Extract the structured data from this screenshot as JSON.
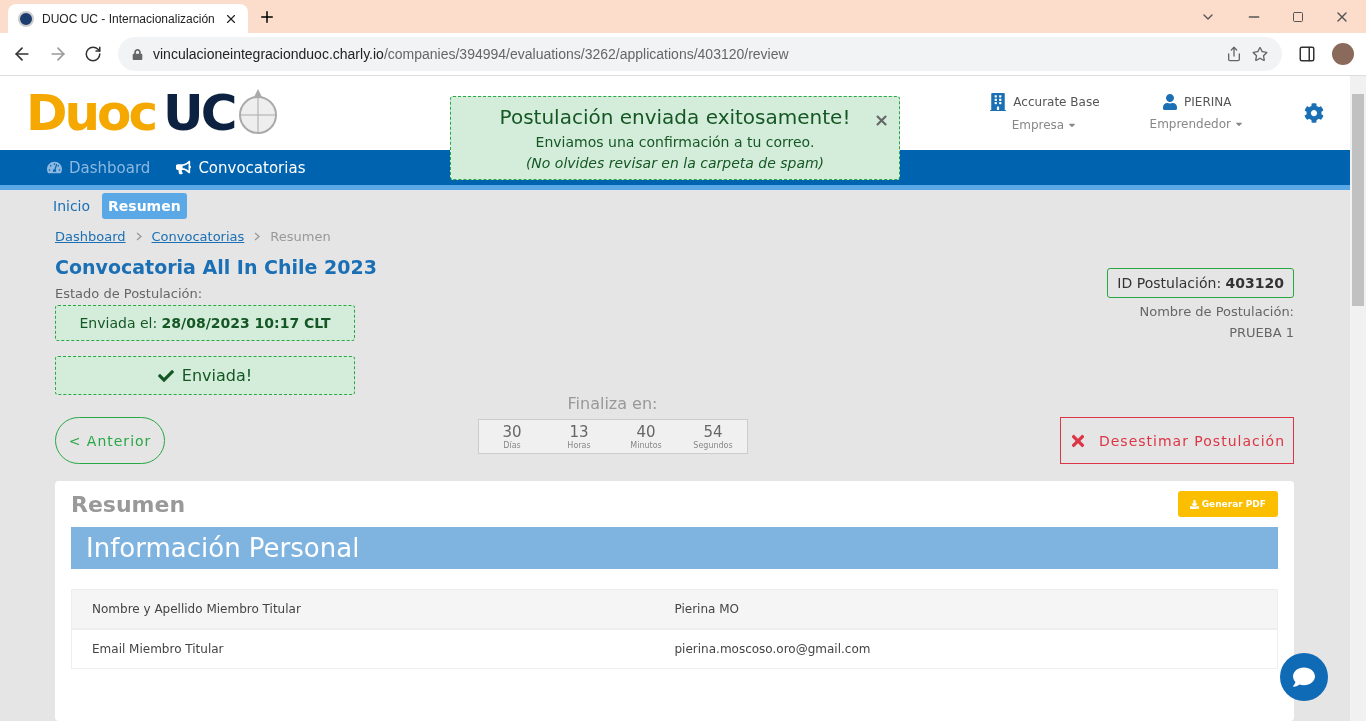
{
  "browser": {
    "tabs": [
      {
        "title": "DUOC UC - Internacionalización",
        "selected": true
      }
    ],
    "url": {
      "host": "vinculacioneintegracionduoc.charly.io",
      "path": "/companies/394994/evaluations/3262/applications/403120/review"
    }
  },
  "logo": {
    "part_1": "Duoc",
    "part_2": "UC"
  },
  "toast": {
    "title": "Postulación enviada exitosamente!",
    "close": "×",
    "message": "Enviamos una confirmación a tu correo.",
    "note": "(No olvides revisar en la carpeta de spam)"
  },
  "account": [
    {
      "kind": "company",
      "name": "Accurate Base",
      "role": "Empresa"
    },
    {
      "kind": "user",
      "name": "PIERINA",
      "role": "Emprendedor"
    }
  ],
  "nav": [
    {
      "kind": "dashboard",
      "label": "Dashboard",
      "selected": false
    },
    {
      "kind": "calls",
      "label": "Convocatorias",
      "selected": true
    }
  ],
  "subnav": [
    {
      "label": "Inicio",
      "selected": false
    },
    {
      "label": "Resumen",
      "selected": true
    }
  ],
  "breadcrumb": [
    {
      "label": "Dashboard",
      "kind": "link"
    },
    {
      "label": "Convocatorias",
      "kind": "link"
    },
    {
      "label": "Resumen",
      "kind": "current"
    }
  ],
  "title": "Convocatoria All In Chile 2023",
  "status": {
    "label": "Estado de Postulación:",
    "sent_on": "Enviada el: **28/08/2023 10:17 CLT**",
    "badge": "Enviada!"
  },
  "application": {
    "id": "ID Postulación: **403120**",
    "name_label": "Nombre de Postulación:",
    "name": "PRUEBA 1"
  },
  "countdown": {
    "label": "Finaliza en:",
    "units": [
      {
        "value": "30",
        "unit": "Días"
      },
      {
        "value": "13",
        "unit": "Horas"
      },
      {
        "value": "40",
        "unit": "Minutos"
      },
      {
        "value": "54",
        "unit": "Segundos"
      }
    ]
  },
  "buttons": {
    "back": "< Anterior",
    "dismiss": "Desestimar Postulación",
    "pdf": "Generar PDF"
  },
  "summary": {
    "title": "Resumen",
    "section": "Información Personal",
    "rows": [
      {
        "field": "Nombre y Apellido Miembro Titular",
        "value": "Pierina MO"
      },
      {
        "field": "Email Miembro Titular",
        "value": "pierina.moscoso.oro@gmail.com"
      }
    ]
  }
}
